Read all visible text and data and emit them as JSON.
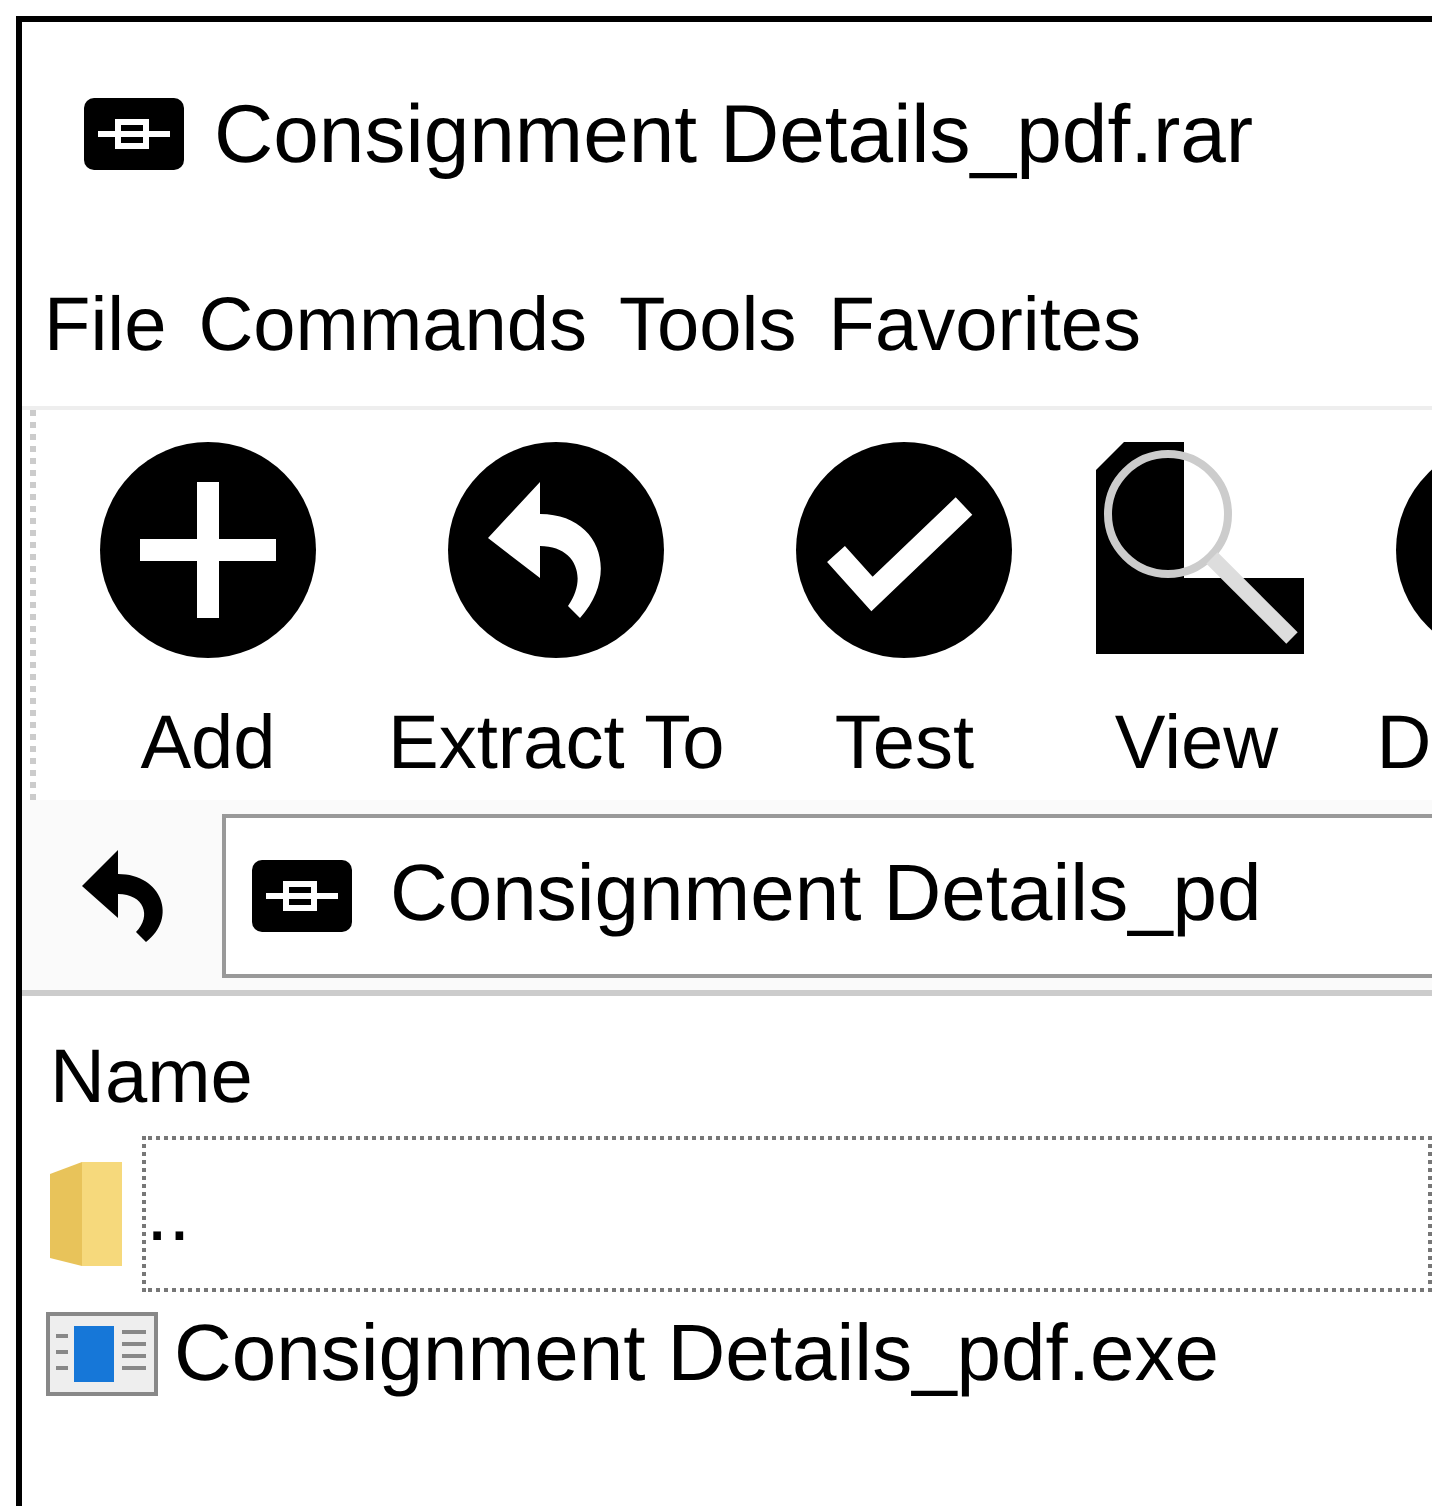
{
  "window": {
    "title": "Consignment Details_pdf.rar"
  },
  "menu": [
    {
      "label": "File"
    },
    {
      "label": "Commands"
    },
    {
      "label": "Tools"
    },
    {
      "label": "Favorites"
    }
  ],
  "toolbar": [
    {
      "kind": "add",
      "label": "Add"
    },
    {
      "kind": "extract",
      "label": "Extract To"
    },
    {
      "kind": "test",
      "label": "Test"
    },
    {
      "kind": "view",
      "label": "View"
    },
    {
      "kind": "cut",
      "label": "D"
    }
  ],
  "address": {
    "value": "Consignment Details_pd"
  },
  "file_list": {
    "columns": [
      "Name"
    ],
    "rows": [
      {
        "kind": "folder",
        "name": "..",
        "focused": true
      },
      {
        "kind": "exe",
        "name": "Consignment Details_pdf.exe",
        "focused": false
      }
    ]
  }
}
